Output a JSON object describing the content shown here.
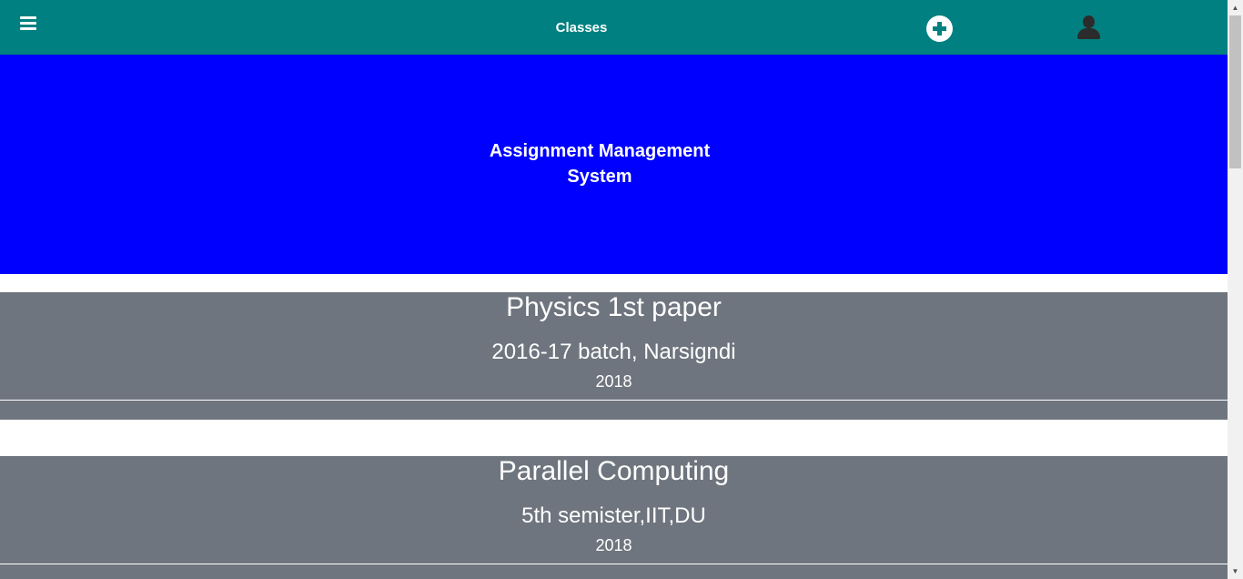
{
  "navbar": {
    "title": "Classes",
    "menu_icon": "hamburger-menu-icon",
    "add_icon": "plus-circle-icon",
    "user_icon": "user-icon",
    "background_color": "#008080"
  },
  "hero": {
    "title_line1": "Assignment Management",
    "title_line2": "System",
    "background_color": "#0000ff"
  },
  "classes": [
    {
      "name": "Physics 1st paper",
      "section": "2016-17 batch, Narsigndi",
      "year": "2018"
    },
    {
      "name": "Parallel Computing",
      "section": "5th semister,IIT,DU",
      "year": "2018"
    }
  ],
  "card_color": "#6f757e"
}
